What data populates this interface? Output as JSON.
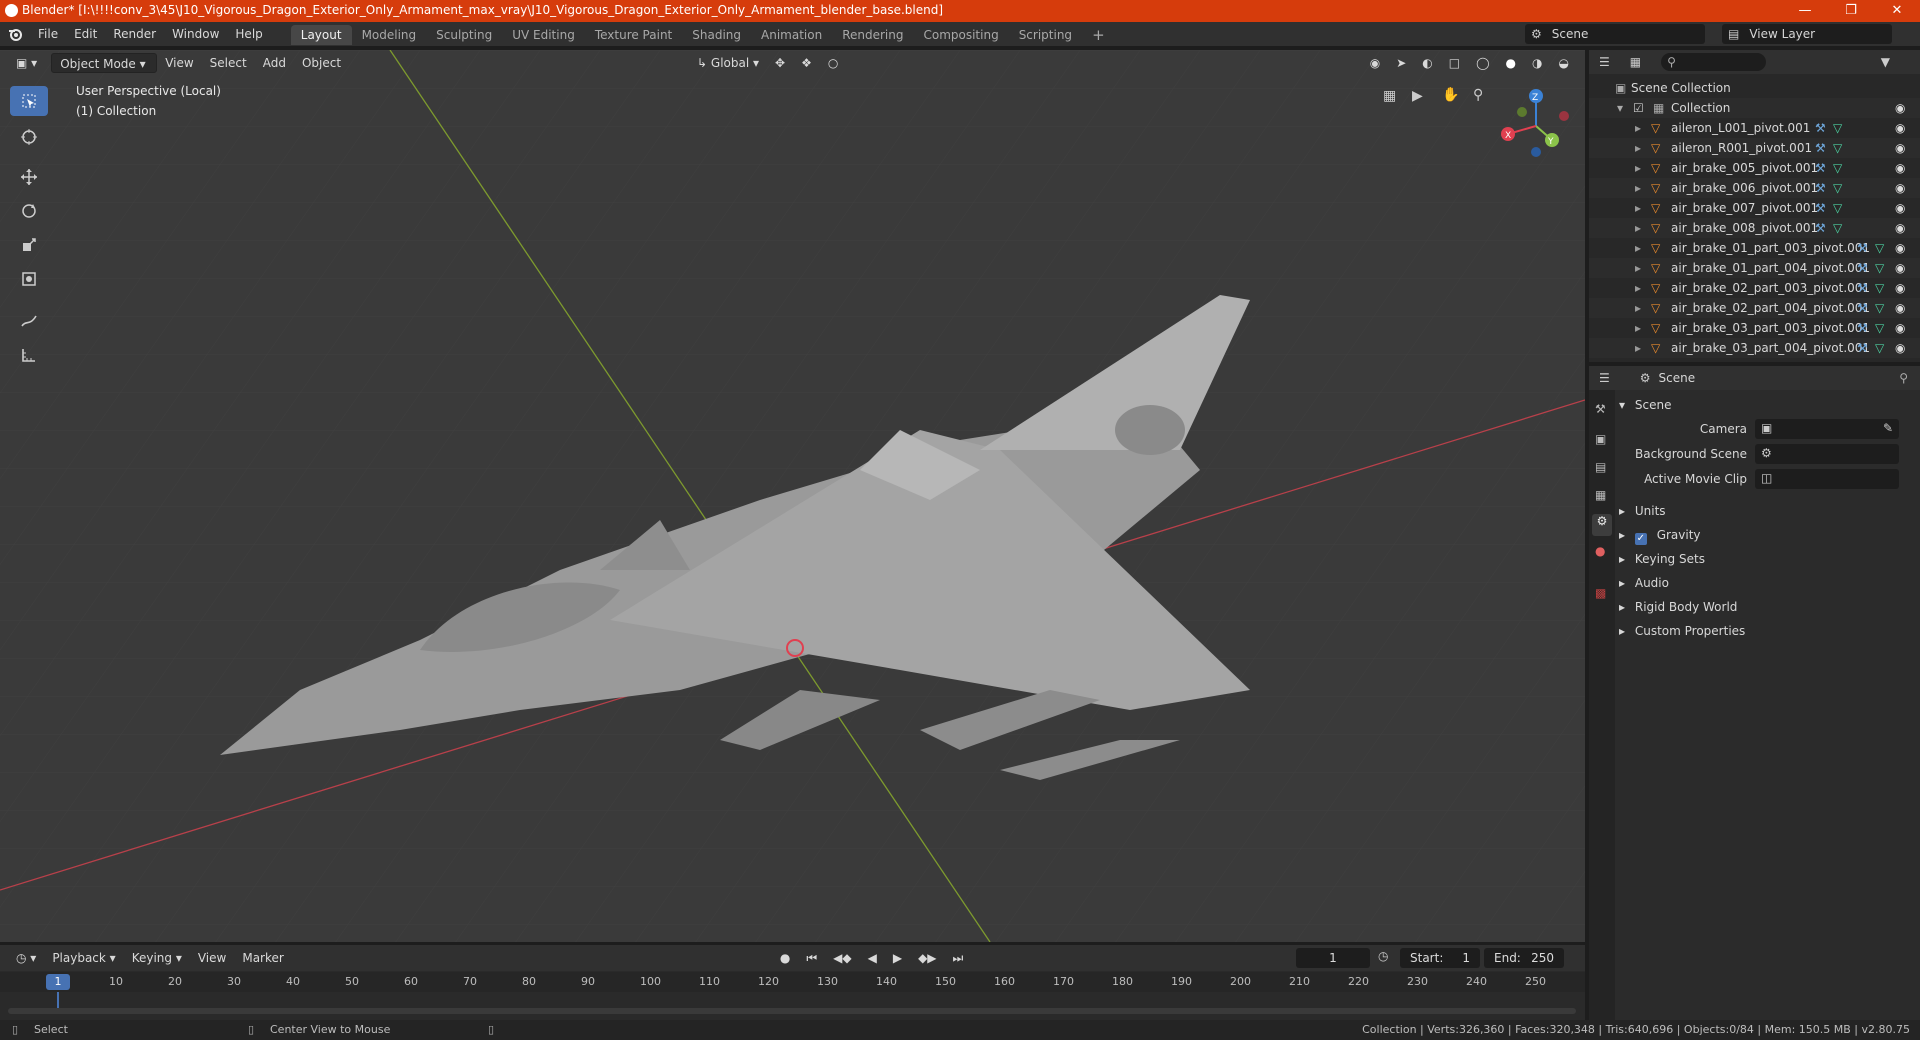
{
  "window": {
    "title": "Blender* [I:\\!!!!conv_3\\45\\J10_Vigorous_Dragon_Exterior_Only_Armament_max_vray\\J10_Vigorous_Dragon_Exterior_Only_Armament_blender_base.blend]"
  },
  "menu": {
    "items": [
      "File",
      "Edit",
      "Render",
      "Window",
      "Help"
    ]
  },
  "workspaces": [
    "Layout",
    "Modeling",
    "Sculpting",
    "UV Editing",
    "Texture Paint",
    "Shading",
    "Animation",
    "Rendering",
    "Compositing",
    "Scripting"
  ],
  "topright": {
    "scene": "Scene",
    "view_layer": "View Layer"
  },
  "viewport": {
    "mode": "Object Mode",
    "menus": [
      "View",
      "Select",
      "Add",
      "Object"
    ],
    "orientation": "Global",
    "overlay_line1": "User Perspective (Local)",
    "overlay_line2": "(1) Collection",
    "gizmo": {
      "x": "X",
      "y": "Y",
      "z": "Z"
    }
  },
  "outliner": {
    "root": "Scene Collection",
    "collection": "Collection",
    "items": [
      "aileron_L001_pivot.001",
      "aileron_R001_pivot.001",
      "air_brake_005_pivot.001",
      "air_brake_006_pivot.001",
      "air_brake_007_pivot.001",
      "air_brake_008_pivot.001",
      "air_brake_01_part_003_pivot.001",
      "air_brake_01_part_004_pivot.001",
      "air_brake_02_part_003_pivot.001",
      "air_brake_02_part_004_pivot.001",
      "air_brake_03_part_003_pivot.001",
      "air_brake_03_part_004_pivot.001"
    ]
  },
  "properties": {
    "context": "Scene",
    "panel": "Scene",
    "camera_label": "Camera",
    "bg_scene_label": "Background Scene",
    "movie_clip_label": "Active Movie Clip",
    "subpanels": [
      "Units",
      "Gravity",
      "Keying Sets",
      "Audio",
      "Rigid Body World",
      "Custom Properties"
    ]
  },
  "timeline": {
    "menus": [
      "Playback",
      "Keying",
      "View",
      "Marker"
    ],
    "current_frame": "1",
    "start_label": "Start:",
    "start": "1",
    "end_label": "End:",
    "end": "250",
    "ticks": [
      "10",
      "20",
      "30",
      "40",
      "50",
      "60",
      "70",
      "80",
      "90",
      "100",
      "110",
      "120",
      "130",
      "140",
      "150",
      "160",
      "170",
      "180",
      "190",
      "200",
      "210",
      "220",
      "230",
      "240",
      "250"
    ],
    "current_marker": "1"
  },
  "status": {
    "left": "Select",
    "middle": "Center View to Mouse",
    "right": "Collection | Verts:326,360 | Faces:320,348 | Tris:640,696 | Objects:0/84 | Mem: 150.5 MB | v2.80.75"
  },
  "colors": {
    "title_bar": "#d63c0c",
    "accent": "#4772b3",
    "x_axis": "#e04050",
    "y_axis": "#8bc34a",
    "z_axis": "#3b82d6"
  }
}
